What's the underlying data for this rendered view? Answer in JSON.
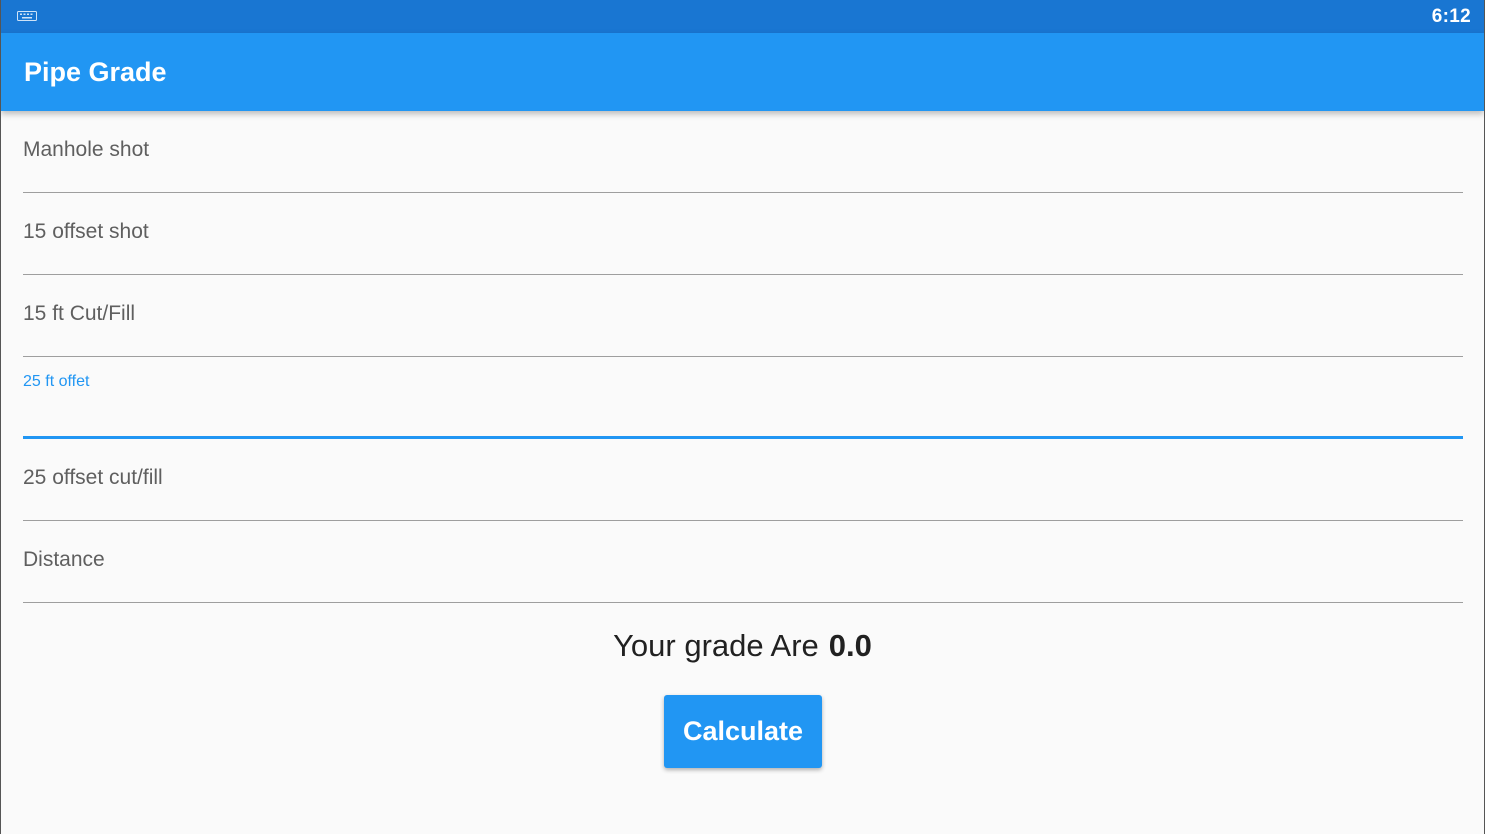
{
  "status_bar": {
    "time": "6:12",
    "left_icon": "keyboard-icon"
  },
  "app_bar": {
    "title": "Pipe Grade"
  },
  "fields": [
    {
      "label": "Manhole shot",
      "value": "",
      "focused": false
    },
    {
      "label": "15 offset shot",
      "value": "",
      "focused": false
    },
    {
      "label": "15 ft Cut/Fill",
      "value": "",
      "focused": false
    },
    {
      "label": "25 ft offet",
      "value": "",
      "focused": true
    },
    {
      "label": "25 offset cut/fill",
      "value": "",
      "focused": false
    },
    {
      "label": "Distance",
      "value": "",
      "focused": false
    }
  ],
  "result": {
    "label": "Your grade Are",
    "value": "0.0"
  },
  "calculate_button": {
    "label": "Calculate"
  },
  "colors": {
    "status_bar": "#1976d2",
    "app_bar": "#2196f3",
    "accent": "#2196f3",
    "background": "#fafafa"
  }
}
